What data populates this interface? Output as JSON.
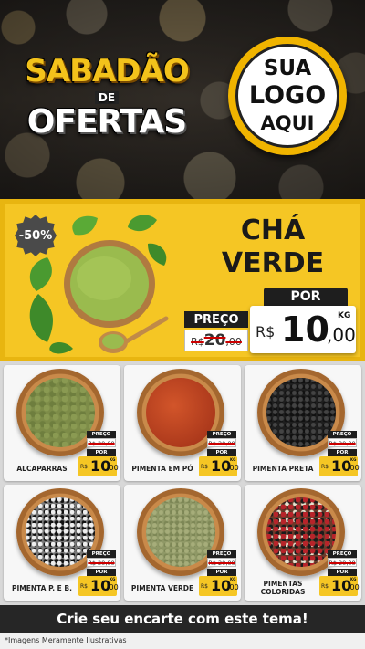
{
  "header": {
    "title_line1": "SABADÃO",
    "title_line2": "DE",
    "title_line3": "OFERTAS",
    "logo_line1": "SUA",
    "logo_line2": "LOGO",
    "logo_line3": "AQUI"
  },
  "featured": {
    "discount": "-50%",
    "name_line1": "CHÁ",
    "name_line2": "VERDE",
    "por_label": "POR",
    "preco_label": "PREÇO",
    "old_currency": "R$",
    "old_int": "20",
    "old_dec": ",00",
    "new_currency": "R$",
    "new_int": "10",
    "new_dec": ",00",
    "unit": "KG"
  },
  "products": [
    {
      "name": "ALCAPARRAS",
      "preco_label": "PREÇO",
      "old_price": "R$ 20,00",
      "por_label": "POR",
      "currency": "R$",
      "price_int": "10",
      "price_dec": ",00",
      "unit": "KG"
    },
    {
      "name": "PIMENTA EM PÓ",
      "preco_label": "PREÇO",
      "old_price": "R$ 20,00",
      "por_label": "POR",
      "currency": "R$",
      "price_int": "10",
      "price_dec": ",00",
      "unit": "KG"
    },
    {
      "name": "PIMENTA PRETA",
      "preco_label": "PREÇO",
      "old_price": "R$ 20,00",
      "por_label": "POR",
      "currency": "R$",
      "price_int": "10",
      "price_dec": ",00",
      "unit": "KG"
    },
    {
      "name": "PIMENTA P. E B.",
      "preco_label": "PREÇO",
      "old_price": "R$ 20,00",
      "por_label": "POR",
      "currency": "R$",
      "price_int": "10",
      "price_dec": ",00",
      "unit": "KG"
    },
    {
      "name": "PIMENTA VERDE",
      "preco_label": "PREÇO",
      "old_price": "R$ 20,00",
      "por_label": "POR",
      "currency": "R$",
      "price_int": "10",
      "price_dec": ",00",
      "unit": "KG"
    },
    {
      "name": "PIMENTAS COLORIDAS",
      "preco_label": "PREÇO",
      "old_price": "R$ 20,00",
      "por_label": "POR",
      "currency": "R$",
      "price_int": "10",
      "price_dec": ",00",
      "unit": "KG"
    }
  ],
  "footer": {
    "cta": "Crie seu encarte com este tema!",
    "disclaimer": "*Imagens Meramente Ilustrativas"
  },
  "colors": {
    "accent_yellow": "#f5c624",
    "dark": "#1e1e1e"
  }
}
